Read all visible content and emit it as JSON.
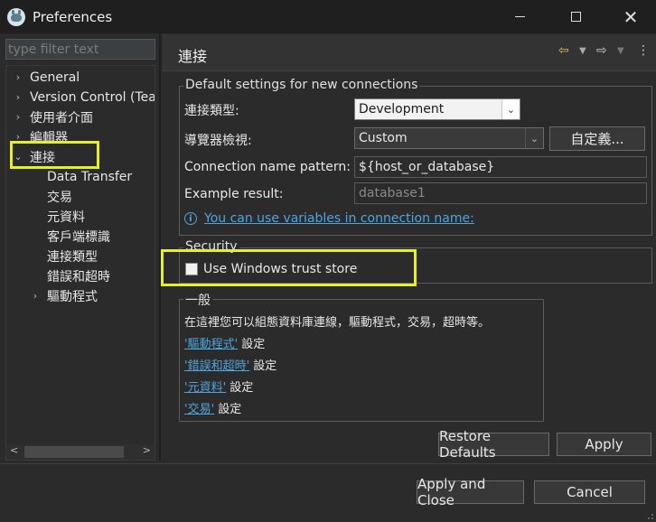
{
  "window": {
    "title": "Preferences"
  },
  "filter": {
    "placeholder": "type filter text"
  },
  "tree": [
    {
      "label": "General",
      "expander": "›"
    },
    {
      "label": "Version Control (Tea",
      "expander": "›"
    },
    {
      "label": "使用者介面",
      "expander": "›"
    },
    {
      "label": "編輯器",
      "expander": "›"
    },
    {
      "label": "連接",
      "expander": "⌄"
    },
    {
      "label": "Data Transfer"
    },
    {
      "label": "交易"
    },
    {
      "label": "元資料"
    },
    {
      "label": "客戶端標識"
    },
    {
      "label": "連接類型"
    },
    {
      "label": "錯誤和超時"
    },
    {
      "label": "驅動程式",
      "expander": "›"
    }
  ],
  "page": {
    "title": "連接"
  },
  "defaults": {
    "legend": "Default settings for new connections",
    "conn_type_label": "連接類型:",
    "conn_type_value": "Development",
    "navigator_label": "導覽器檢視:",
    "navigator_value": "Custom",
    "customize_button": "自定義...",
    "pattern_label": "Connection name pattern:",
    "pattern_value": "${host_or_database}",
    "example_label": "Example result:",
    "example_value": "database1",
    "variables_link": "You can use variables in connection name:"
  },
  "security": {
    "legend": "Security",
    "trust_store_label": "Use Windows trust store",
    "trust_store_checked": false
  },
  "general": {
    "legend": "一般",
    "description": "在這裡您可以組態資料庫連線，驅動程式，交易，超時等。",
    "links": [
      {
        "link": "'驅動程式'",
        "suffix": " 設定"
      },
      {
        "link": "'錯誤和超時'",
        "suffix": " 設定"
      },
      {
        "link": "'元資料'",
        "suffix": " 設定"
      },
      {
        "link": "'交易'",
        "suffix": " 設定"
      }
    ]
  },
  "buttons": {
    "restore_defaults": "Restore Defaults",
    "apply": "Apply",
    "apply_and_close": "Apply and Close",
    "cancel": "Cancel"
  },
  "colors": {
    "highlight": "#e6f028",
    "link": "#4fa5de",
    "nav_back": "#e5b84d"
  }
}
